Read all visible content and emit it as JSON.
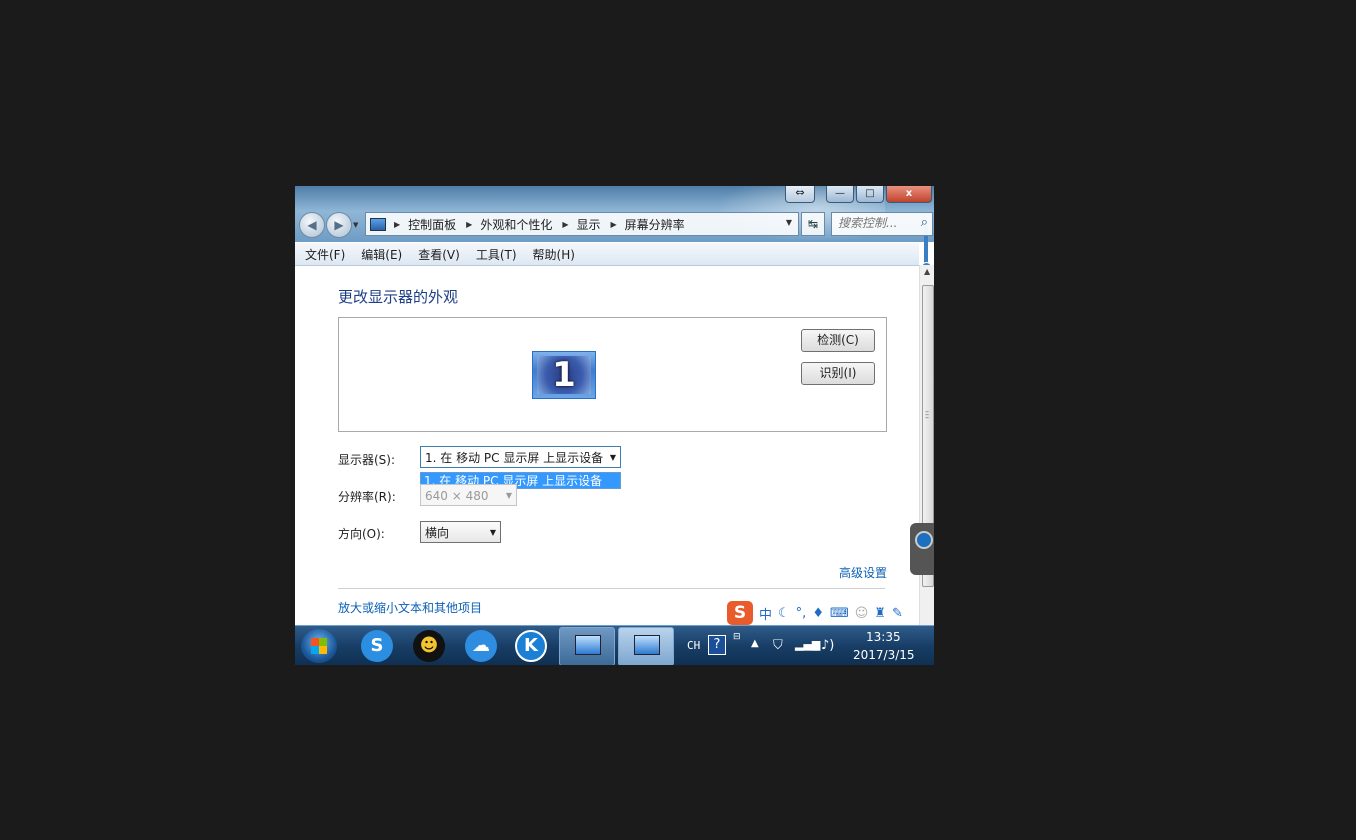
{
  "window": {
    "caption_buttons": {
      "minimize": "—",
      "maximize": "□",
      "close": "x",
      "restore": "⇔"
    },
    "address": {
      "crumbs": [
        "控制面板",
        "外观和个性化",
        "显示",
        "屏幕分辨率"
      ]
    },
    "search": {
      "placeholder": "搜索控制..."
    }
  },
  "menu": {
    "items": [
      "文件(F)",
      "编辑(E)",
      "查看(V)",
      "工具(T)",
      "帮助(H)"
    ]
  },
  "content": {
    "title": "更改显示器的外观",
    "monitor_number": "1",
    "detect_button": "检测(C)",
    "identify_button": "识别(I)",
    "display_label": "显示器(S):",
    "display_value": "1. 在 移动 PC 显示屏 上显示设备",
    "display_options": [
      "1. 在 移动 PC 显示屏 上显示设备"
    ],
    "resolution_label": "分辨率(R):",
    "resolution_value": "640 × 480",
    "orientation_label": "方向(O):",
    "orientation_value": "横向",
    "advanced_link": "高级设置",
    "bottom_link": "放大或缩小文本和其他项目"
  },
  "ime": {
    "logo": "S",
    "mode": "中",
    "icons": [
      "moon-icon",
      "punctuation-icon",
      "microphone-icon",
      "keyboard-icon",
      "user-icon",
      "shirt-icon",
      "wrench-icon"
    ]
  },
  "taskbar": {
    "language": "CH",
    "time": "13:35",
    "date": "2017/3/15",
    "apps": [
      "sogou-browser",
      "qq",
      "cloud-app",
      "k-app"
    ]
  },
  "colors": {
    "accent": "#1e3f87",
    "link": "#0d60b6",
    "selection": "#3399ff",
    "taskbar": "#183e66"
  }
}
